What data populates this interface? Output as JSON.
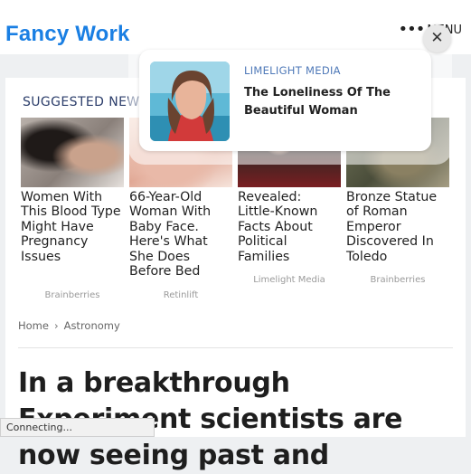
{
  "header": {
    "logo": "Fancy Work",
    "menu_dots": "•••",
    "menu_label": "MENU"
  },
  "suggested": {
    "heading": "SUGGESTED NEW",
    "items": [
      {
        "title": "Women With This Blood Type Might Have Pregnancy Issues",
        "source": "Brainberries"
      },
      {
        "title": "66-Year-Old Woman With Baby Face. Here's What She Does Before Bed",
        "source": "Retinlift"
      },
      {
        "title": "Revealed: Little-Known Facts About Political Families",
        "source": "Limelight Media"
      },
      {
        "title": "Bronze Statue of Roman Emperor Discovered In Toledo",
        "source": "Brainberries"
      }
    ]
  },
  "breadcrumb": {
    "home": "Home",
    "separator": "›",
    "current": "Astronomy"
  },
  "article": {
    "headline": "In a breakthrough Experiment scientists are now seeing past and"
  },
  "popup": {
    "source": "LIMELIGHT MEDIA",
    "title": "The Loneliness Of The Beautiful Woman",
    "close_glyph": "✕"
  },
  "status": {
    "text": "Connecting..."
  }
}
